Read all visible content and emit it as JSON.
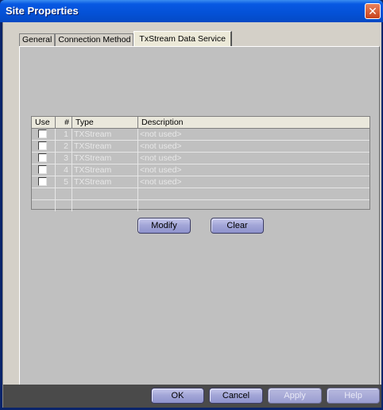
{
  "window": {
    "title": "Site Properties"
  },
  "tabs": [
    {
      "label": "General"
    },
    {
      "label": "Connection Method"
    },
    {
      "label": "TxStream Data Service"
    }
  ],
  "grid": {
    "columns": [
      "Use",
      "#",
      "Type",
      "Description"
    ],
    "rows": [
      {
        "num": "1",
        "type": "TXStream",
        "description": "<not used>"
      },
      {
        "num": "2",
        "type": "TXStream",
        "description": "<not used>"
      },
      {
        "num": "3",
        "type": "TXStream",
        "description": "<not used>"
      },
      {
        "num": "4",
        "type": "TXStream",
        "description": "<not used>"
      },
      {
        "num": "5",
        "type": "TXStream",
        "description": "<not used>"
      }
    ]
  },
  "actions": {
    "modify": "Modify",
    "clear": "Clear"
  },
  "footer": {
    "ok": "OK",
    "cancel": "Cancel",
    "apply": "Apply",
    "help": "Help"
  },
  "colors": {
    "title_bar": "#0451d6",
    "dialog_bg": "#c0c0c0",
    "button_accent": "#a4a7d8"
  }
}
